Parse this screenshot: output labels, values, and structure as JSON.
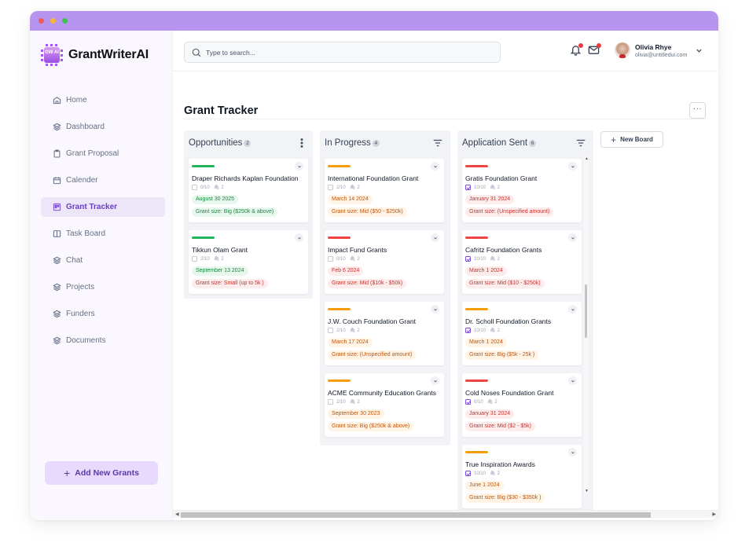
{
  "window": {
    "controls": [
      "close",
      "minimize",
      "maximize"
    ]
  },
  "app": {
    "name": "GrantWriterAI",
    "logo_text": "GW AI"
  },
  "sidebar": {
    "items": [
      {
        "label": "Home",
        "icon": "home-icon",
        "active": false
      },
      {
        "label": "Dashboard",
        "icon": "layers-icon",
        "active": false
      },
      {
        "label": "Grant Proposal",
        "icon": "clipboard-icon",
        "active": false
      },
      {
        "label": "Calender",
        "icon": "calendar-icon",
        "active": false
      },
      {
        "label": "Grant Tracker",
        "icon": "kanban-icon",
        "active": true
      },
      {
        "label": "Task Board",
        "icon": "columns-icon",
        "active": false
      },
      {
        "label": "Chat",
        "icon": "layers-icon",
        "active": false
      },
      {
        "label": "Projects",
        "icon": "layers-icon",
        "active": false
      },
      {
        "label": "Funders",
        "icon": "layers-icon",
        "active": false
      },
      {
        "label": "Documents",
        "icon": "layers-icon",
        "active": false
      }
    ],
    "add_button": "Add New Grants"
  },
  "header": {
    "search_placeholder": "Type to search...",
    "notifications_unread": true,
    "messages_unread": true,
    "user": {
      "name": "Olivia Rhye",
      "email": "olivia@untitledui.com"
    }
  },
  "page": {
    "title": "Grant Tracker",
    "more_label": "···",
    "new_board_label": "New Board"
  },
  "colors": {
    "accent": "#7b4fd6",
    "green": "#22b35e",
    "orange": "#f59e0b",
    "red": "#ef4444"
  },
  "boards": [
    {
      "title": "Opportunities",
      "count": "2",
      "action_icon": "more-vertical-icon",
      "cards": [
        {
          "name": "Draper Richards Kaplan Foundation",
          "priority": "green",
          "checked": false,
          "tasks": "0/10",
          "attachments": "2",
          "date": "August 30 2025",
          "date_tone": "green",
          "size": "Grant size: Big ($250k & above)",
          "size_tone": "green"
        },
        {
          "name": "Tikkun Olam Grant",
          "priority": "green",
          "checked": false,
          "tasks": "2/10",
          "attachments": "2",
          "date": "September 13 2024",
          "date_tone": "green",
          "size": "Grant size: Small (up to 5k )",
          "size_tone": "red"
        }
      ]
    },
    {
      "title": "In Progress",
      "count": "4",
      "action_icon": "filter-icon",
      "cards": [
        {
          "name": "International Foundation Grant",
          "priority": "orange",
          "checked": false,
          "tasks": "2/10",
          "attachments": "2",
          "date": "March 14 2024",
          "date_tone": "orange",
          "size": "Grant size: Mid ($50 - $250k)",
          "size_tone": "orange"
        },
        {
          "name": "Impact Fund Grants",
          "priority": "red",
          "checked": false,
          "tasks": "0/10",
          "attachments": "2",
          "date": "Feb 6 2024",
          "date_tone": "red",
          "size": "Grant size: Mid ($10k - $50k)",
          "size_tone": "red"
        },
        {
          "name": "J.W. Couch Foundation Grant",
          "priority": "orange",
          "checked": false,
          "tasks": "2/10",
          "attachments": "2",
          "date": "March 17 2024",
          "date_tone": "orange",
          "size": "Grant size: (Unspecified amount)",
          "size_tone": "orange"
        },
        {
          "name": "ACME Community Education Grants",
          "priority": "orange",
          "checked": false,
          "tasks": "2/10",
          "attachments": "2",
          "date": "September 30 2023",
          "date_tone": "orange",
          "size": "Grant size: Big ($250k & above)",
          "size_tone": "orange"
        }
      ]
    },
    {
      "title": "Application Sent",
      "count": "6",
      "action_icon": "filter-icon",
      "cards": [
        {
          "name": "Gratis Foundation Grant",
          "priority": "red",
          "checked": true,
          "tasks": "10/10",
          "attachments": "2",
          "date": "January 31 2024",
          "date_tone": "red",
          "size": "Grant size: (Unspecified amount)",
          "size_tone": "red"
        },
        {
          "name": "Cafritz Foundation Grants",
          "priority": "red",
          "checked": true,
          "tasks": "10/10",
          "attachments": "2",
          "date": "March 1 2024",
          "date_tone": "red",
          "size": "Grant size: Mid ($10 - $250k)",
          "size_tone": "red"
        },
        {
          "name": "Dr. Scholl Foundation Grants",
          "priority": "orange",
          "checked": true,
          "tasks": "10/10",
          "attachments": "2",
          "date": "March 1 2024",
          "date_tone": "orange",
          "size": "Grant size: Big ($5k - 25k )",
          "size_tone": "orange"
        },
        {
          "name": "Cold Noses Foundation Grant",
          "priority": "red",
          "checked": true,
          "tasks": "0/10",
          "attachments": "2",
          "date": "January 31 2024",
          "date_tone": "red",
          "size": "Grant size: Mid ($2 - $5k)",
          "size_tone": "red"
        },
        {
          "name": "True Inspiration Awards",
          "priority": "orange",
          "checked": true,
          "tasks": "10/10",
          "attachments": "2",
          "date": "June 1 2024",
          "date_tone": "orange",
          "size": "Grant size: Big ($30 - $350k )",
          "size_tone": "orange"
        }
      ]
    }
  ],
  "scroll": {
    "application_sent_vertical_position": 0.45,
    "horizontal_visible_fraction": 0.88
  }
}
